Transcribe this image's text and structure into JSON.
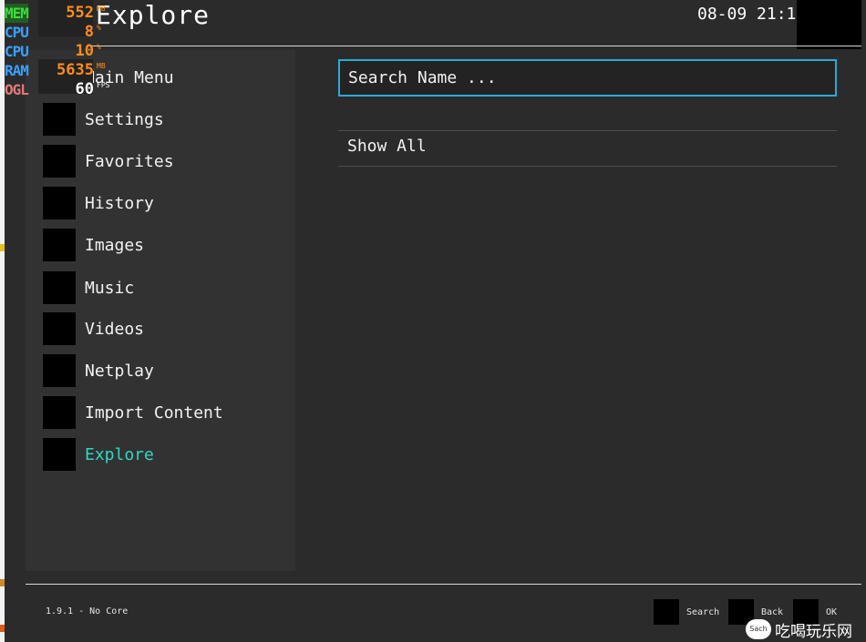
{
  "header": {
    "title": "Explore",
    "clock": "08-09 21:13"
  },
  "sidebar": {
    "items": [
      {
        "label": "Main Menu",
        "active": false
      },
      {
        "label": "Settings",
        "active": false
      },
      {
        "label": "Favorites",
        "active": false
      },
      {
        "label": "History",
        "active": false
      },
      {
        "label": "Images",
        "active": false
      },
      {
        "label": "Music",
        "active": false
      },
      {
        "label": "Videos",
        "active": false
      },
      {
        "label": "Netplay",
        "active": false
      },
      {
        "label": "Import Content",
        "active": false
      },
      {
        "label": "Explore",
        "active": true
      }
    ]
  },
  "main": {
    "search_label": "Search Name ...",
    "show_all": "Show All"
  },
  "footer": {
    "version": "1.9.1 - No Core",
    "hints": [
      {
        "label": "Search"
      },
      {
        "label": "Back"
      },
      {
        "label": "OK"
      }
    ]
  },
  "osd": {
    "rows": [
      {
        "key": "MEM",
        "value": "552",
        "unit": "MB",
        "key_color": "#3ddc3d",
        "key_bg": "#1f5f1f",
        "val_color": "#ff8c1a"
      },
      {
        "key": "CPU",
        "value": "8",
        "unit": "%",
        "key_color": "#3aa0ff",
        "key_bg": "#2b2b2b",
        "val_color": "#ff8c1a"
      },
      {
        "key": "CPU",
        "value": "10",
        "unit": "%",
        "key_color": "#3aa0ff",
        "key_bg": "#2b2b2b",
        "val_color": "#ff8c1a"
      },
      {
        "key": "RAM",
        "value": "5635",
        "unit": "MB",
        "key_color": "#3aa0ff",
        "key_bg": "#2b2b2b",
        "val_color": "#ff8c1a"
      },
      {
        "key": "OGL",
        "value": "60",
        "unit": "FPS",
        "key_color": "#e07a7a",
        "key_bg": "#2b2b2b",
        "val_color": "#ffffff"
      }
    ]
  },
  "watermark": {
    "logo": "Sach",
    "text": "吃喝玩乐网"
  },
  "colors": {
    "accent": "#2fd8c4",
    "search_border": "#2ba9d6",
    "background": "#2b2b2b",
    "sidebar": "#323232"
  }
}
